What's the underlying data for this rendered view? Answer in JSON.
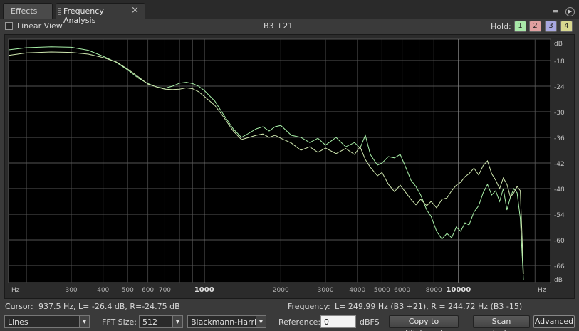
{
  "tabs": [
    {
      "label": "Effects"
    },
    {
      "label": "Frequency Analysis",
      "close": "×"
    }
  ],
  "top": {
    "linear_view_label": "Linear View",
    "linear_view_checked": false,
    "note_readout": "B3 +21",
    "hold_label": "Hold:",
    "hold_buttons": [
      "1",
      "2",
      "3",
      "4"
    ],
    "hold_colors": [
      "#a8e8a8",
      "#e0a0a0",
      "#a8a8e0",
      "#d8d890"
    ]
  },
  "icons": {
    "menu": "menu-icon",
    "play": "play-icon"
  },
  "chart_data": {
    "type": "line",
    "x_scale": "log",
    "x_unit": "Hz",
    "y_unit": "dB",
    "xlim": [
      170,
      23000
    ],
    "ylim": [
      -70,
      -13
    ],
    "x_ticks": [
      300,
      400,
      500,
      600,
      700,
      1000,
      2000,
      3000,
      4000,
      5000,
      6000,
      8000,
      10000
    ],
    "x_tick_labels": [
      "300",
      "400",
      "500",
      "600",
      "700",
      "1000",
      "2000",
      "3000",
      "4000",
      "5000",
      "6000",
      "8000",
      "10000"
    ],
    "x_edge_labels": [
      "Hz",
      "Hz"
    ],
    "y_ticks": [
      -18,
      -24,
      -30,
      -36,
      -42,
      -48,
      -54,
      -60,
      -66
    ],
    "y_tick_labels": [
      "-18",
      "-24",
      "-30",
      "-36",
      "-42",
      "-48",
      "-54",
      "-60",
      "-66"
    ],
    "y_edge_labels": [
      "dB",
      "dB"
    ],
    "grid": true,
    "series": [
      {
        "color": "#a8f0a8",
        "points": [
          [
            170,
            -15.5
          ],
          [
            200,
            -15
          ],
          [
            250,
            -14.8
          ],
          [
            300,
            -14.9
          ],
          [
            350,
            -15.6
          ],
          [
            400,
            -17
          ],
          [
            450,
            -18.4
          ],
          [
            500,
            -20.2
          ],
          [
            550,
            -22.1
          ],
          [
            600,
            -23.4
          ],
          [
            650,
            -24.2
          ],
          [
            700,
            -24.5
          ],
          [
            750,
            -24
          ],
          [
            800,
            -23.3
          ],
          [
            850,
            -23.1
          ],
          [
            900,
            -23.4
          ],
          [
            950,
            -24
          ],
          [
            1000,
            -25
          ],
          [
            1100,
            -27.5
          ],
          [
            1200,
            -31
          ],
          [
            1300,
            -34
          ],
          [
            1400,
            -36
          ],
          [
            1500,
            -35
          ],
          [
            1600,
            -34
          ],
          [
            1700,
            -33.5
          ],
          [
            1800,
            -34.5
          ],
          [
            1900,
            -33.5
          ],
          [
            2000,
            -33.2
          ],
          [
            2200,
            -35.5
          ],
          [
            2400,
            -36
          ],
          [
            2600,
            -37.2
          ],
          [
            2800,
            -36.2
          ],
          [
            3000,
            -37.8
          ],
          [
            3300,
            -36
          ],
          [
            3600,
            -38.2
          ],
          [
            3900,
            -37.2
          ],
          [
            4100,
            -38.5
          ],
          [
            4300,
            -35.5
          ],
          [
            4500,
            -40
          ],
          [
            4800,
            -42.5
          ],
          [
            5000,
            -42
          ],
          [
            5300,
            -40.5
          ],
          [
            5600,
            -40.8
          ],
          [
            5900,
            -40
          ],
          [
            6200,
            -43
          ],
          [
            6500,
            -46
          ],
          [
            6800,
            -47.5
          ],
          [
            7100,
            -49.5
          ],
          [
            7500,
            -53
          ],
          [
            7800,
            -54.5
          ],
          [
            8200,
            -58
          ],
          [
            8600,
            -59.8
          ],
          [
            9000,
            -58.5
          ],
          [
            9400,
            -59.5
          ],
          [
            9800,
            -57
          ],
          [
            10200,
            -58
          ],
          [
            10600,
            -56
          ],
          [
            11000,
            -56.5
          ],
          [
            11500,
            -53.5
          ],
          [
            12000,
            -52
          ],
          [
            12500,
            -49
          ],
          [
            13000,
            -47
          ],
          [
            13500,
            -49.5
          ],
          [
            14000,
            -48.5
          ],
          [
            14500,
            -51
          ],
          [
            15000,
            -48
          ],
          [
            15500,
            -53
          ],
          [
            16000,
            -50
          ],
          [
            16500,
            -48
          ],
          [
            17000,
            -49
          ],
          [
            17500,
            -55
          ],
          [
            18000,
            -69.5
          ]
        ]
      },
      {
        "color": "#d0e8b0",
        "points": [
          [
            170,
            -16.8
          ],
          [
            200,
            -16.2
          ],
          [
            250,
            -16
          ],
          [
            300,
            -16.1
          ],
          [
            350,
            -16.5
          ],
          [
            400,
            -17.3
          ],
          [
            450,
            -18.3
          ],
          [
            500,
            -20
          ],
          [
            550,
            -21.8
          ],
          [
            600,
            -23.5
          ],
          [
            650,
            -24.2
          ],
          [
            700,
            -24.7
          ],
          [
            750,
            -24.8
          ],
          [
            800,
            -24.7
          ],
          [
            850,
            -24.4
          ],
          [
            900,
            -24.6
          ],
          [
            950,
            -25.3
          ],
          [
            1000,
            -26.4
          ],
          [
            1100,
            -28.5
          ],
          [
            1200,
            -31.5
          ],
          [
            1300,
            -34.5
          ],
          [
            1400,
            -36.5
          ],
          [
            1500,
            -36
          ],
          [
            1600,
            -35.5
          ],
          [
            1700,
            -35.2
          ],
          [
            1800,
            -36
          ],
          [
            1900,
            -35.5
          ],
          [
            2000,
            -36.2
          ],
          [
            2200,
            -37.3
          ],
          [
            2400,
            -39
          ],
          [
            2600,
            -38.2
          ],
          [
            2800,
            -39.5
          ],
          [
            3000,
            -38.5
          ],
          [
            3300,
            -39.8
          ],
          [
            3600,
            -38.6
          ],
          [
            3900,
            -40
          ],
          [
            4100,
            -38.2
          ],
          [
            4300,
            -41.2
          ],
          [
            4500,
            -43
          ],
          [
            4800,
            -45
          ],
          [
            5000,
            -44.2
          ],
          [
            5300,
            -47
          ],
          [
            5600,
            -48.7
          ],
          [
            5900,
            -47.2
          ],
          [
            6200,
            -48.9
          ],
          [
            6500,
            -50.5
          ],
          [
            6800,
            -51.8
          ],
          [
            7100,
            -50.5
          ],
          [
            7500,
            -52
          ],
          [
            7800,
            -51
          ],
          [
            8200,
            -52.5
          ],
          [
            8600,
            -50.5
          ],
          [
            9000,
            -50.2
          ],
          [
            9400,
            -48.5
          ],
          [
            9800,
            -47.2
          ],
          [
            10200,
            -46.5
          ],
          [
            10600,
            -45.2
          ],
          [
            11000,
            -44.5
          ],
          [
            11500,
            -43.2
          ],
          [
            12000,
            -44.8
          ],
          [
            12500,
            -42.6
          ],
          [
            13000,
            -41.5
          ],
          [
            13500,
            -44.5
          ],
          [
            14000,
            -46
          ],
          [
            14500,
            -48
          ],
          [
            15000,
            -45.5
          ],
          [
            15500,
            -47
          ],
          [
            16000,
            -50
          ],
          [
            16500,
            -49
          ],
          [
            17000,
            -47.5
          ],
          [
            17500,
            -48.5
          ],
          [
            18000,
            -68
          ]
        ]
      }
    ]
  },
  "status": {
    "cursor_label": "Cursor:",
    "cursor_value": "937.5 Hz, L= -26.4 dB, R=-24.75 dB",
    "frequency_label": "Frequency:",
    "frequency_value": "L= 249.99 Hz (B3 +21), R = 244.72 Hz (B3 -15)"
  },
  "controls": {
    "style_value": "Lines",
    "fft_label": "FFT Size:",
    "fft_value": "512",
    "window_value": "Blackmann-Harris",
    "reference_label": "Reference:",
    "reference_value": "0",
    "reference_unit": "dBFS",
    "copy_label": "Copy to Clipboard",
    "scan_label": "Scan selection",
    "advanced_label": "Advanced"
  }
}
